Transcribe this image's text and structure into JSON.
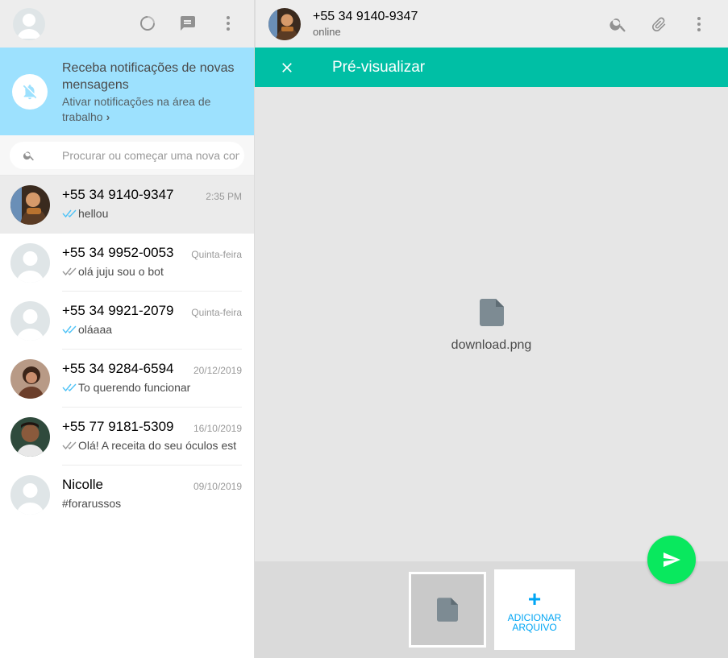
{
  "left_header": {
    "icons": [
      "status-icon",
      "new-chat-icon",
      "menu-icon"
    ]
  },
  "notification": {
    "title": "Receba notificações de novas mensagens",
    "subtitle": "Ativar notificações na área de trabalho",
    "chevron": "›",
    "icon": "bell-off-icon"
  },
  "search": {
    "placeholder": "Procurar ou começar uma nova conversa"
  },
  "chats": [
    {
      "name": "+55 34 9140-9347",
      "time": "2:35 PM",
      "preview": "hellou",
      "tick": "blue"
    },
    {
      "name": "+55 34 9952-0053",
      "time": "Quinta-feira",
      "preview": "olá juju sou o bot",
      "tick": "grey"
    },
    {
      "name": "+55 34 9921-2079",
      "time": "Quinta-feira",
      "preview": "oláaaa",
      "tick": "blue"
    },
    {
      "name": "+55 34 9284-6594",
      "time": "20/12/2019",
      "preview": "To querendo funcionar",
      "tick": "blue"
    },
    {
      "name": "+55 77 9181-5309",
      "time": "16/10/2019",
      "preview": "Olá!  A receita do seu óculos está pronta",
      "tick": "grey"
    },
    {
      "name": "Nicolle",
      "time": "09/10/2019",
      "preview": "#forarussos",
      "tick": "none"
    }
  ],
  "conversation": {
    "name": "+55 34 9140-9347",
    "status": "online",
    "icons": [
      "search-icon",
      "attach-icon",
      "menu-icon"
    ]
  },
  "preview": {
    "title": "Pré-visualizar",
    "file_name": "download.png",
    "add_plus": "+",
    "add_label": "ADICIONAR ARQUIVO"
  },
  "colors": {
    "accent": "#00bfa5",
    "notification_bg": "#9de1fe",
    "send": "#09e85e",
    "add_file": "#00a5f4",
    "read_tick": "#4fc3f7"
  }
}
